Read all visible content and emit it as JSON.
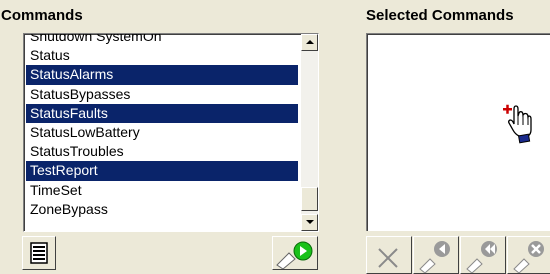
{
  "commands": {
    "title": "Commands",
    "items": [
      {
        "label": "Shutdown SystemOn",
        "selected": false
      },
      {
        "label": "Status",
        "selected": false
      },
      {
        "label": "StatusAlarms",
        "selected": true
      },
      {
        "label": "StatusBypasses",
        "selected": false
      },
      {
        "label": "StatusFaults",
        "selected": true
      },
      {
        "label": "StatusLowBattery",
        "selected": false
      },
      {
        "label": "StatusTroubles",
        "selected": false
      },
      {
        "label": "TestReport",
        "selected": true
      },
      {
        "label": "TimeSet",
        "selected": false
      },
      {
        "label": "ZoneBypass",
        "selected": false
      }
    ]
  },
  "selected_commands": {
    "title": "Selected Commands",
    "items": []
  },
  "icons": {
    "select_all": "list-icon",
    "add": "add-arrow-icon",
    "remove": "remove-icon",
    "move_up": "move-up-icon",
    "move_top": "move-top-icon",
    "clear": "clear-icon",
    "drag_cursor": "hand-cursor-icon"
  },
  "colors": {
    "selection": "#0a246a",
    "panel": "#ece9d8",
    "add_accent": "#19c119"
  }
}
